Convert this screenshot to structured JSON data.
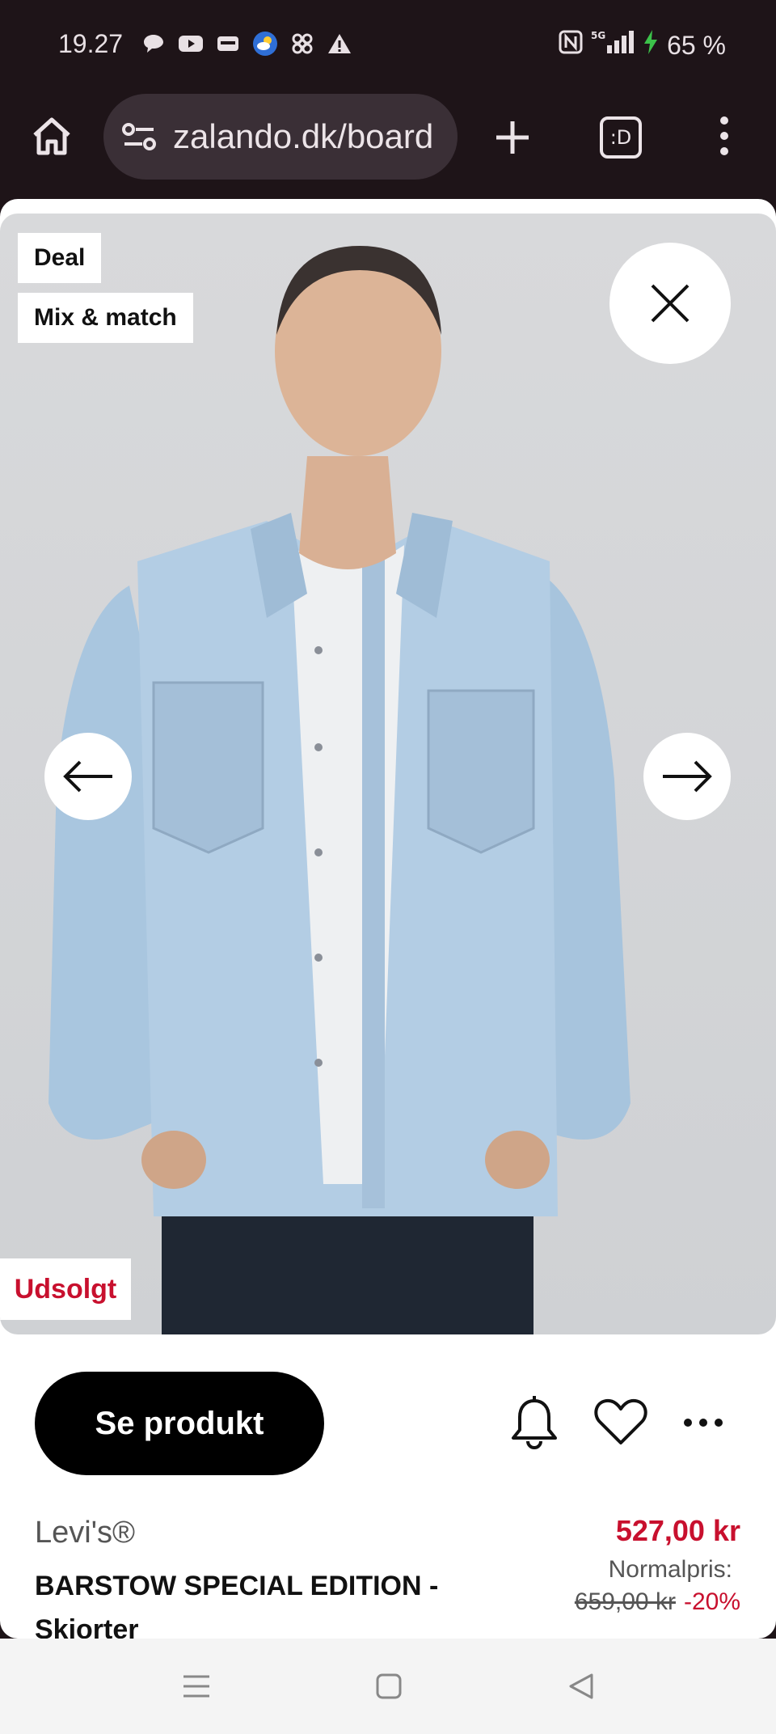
{
  "status_bar": {
    "time": "19.27",
    "network": "5G",
    "battery": "65 %",
    "icons": [
      "chat-icon",
      "youtube-icon",
      "wallet-icon",
      "weather-icon",
      "pinwheel-icon",
      "warning-icon"
    ]
  },
  "browser": {
    "url": "zalando.dk/board",
    "tabs_label": ":D"
  },
  "product": {
    "badges": [
      "Deal",
      "Mix & match"
    ],
    "soldout_label": "Udsolgt",
    "see_button": "Se produkt",
    "brand": "Levi's®",
    "name": "BARSTOW SPECIAL EDITION - Skjorter",
    "price": "527,00 kr",
    "normal_label": "Normalpris:",
    "old_price": "659,00 kr",
    "discount": "-20%"
  },
  "colors": {
    "accent_red": "#c8102e",
    "status_bar_bg": "#1e1418",
    "button_black": "#000000"
  }
}
